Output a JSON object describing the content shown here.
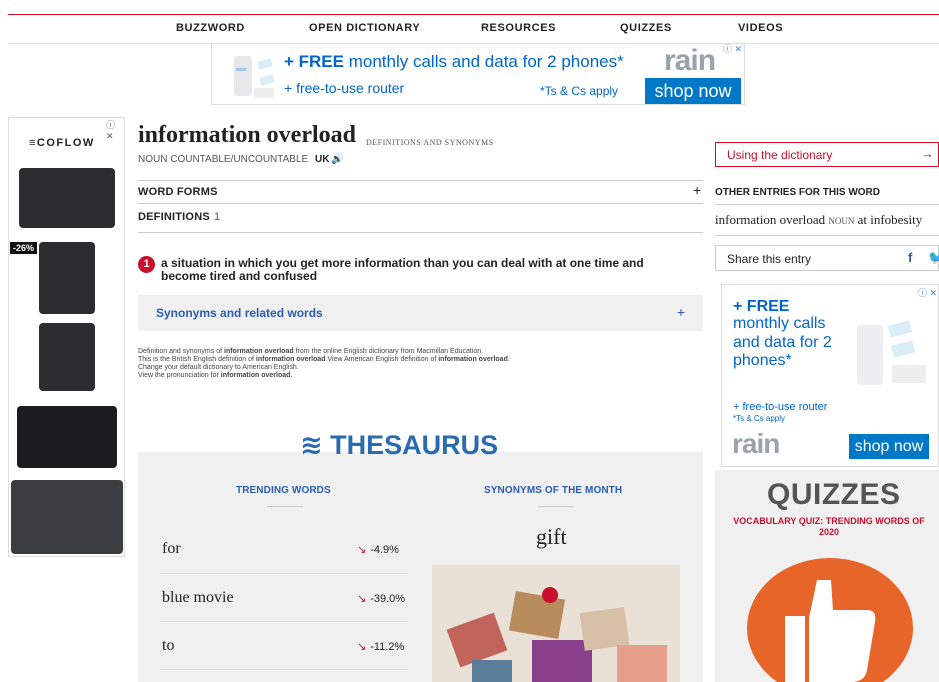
{
  "nav": {
    "items": [
      "BUZZWORD",
      "OPEN DICTIONARY",
      "RESOURCES",
      "QUIZZES",
      "VIDEOS"
    ]
  },
  "top_ad": {
    "free": "+ FREE",
    "line1_rest": " monthly calls and data for 2 phones*",
    "line2": "+ free-to-use router",
    "terms": "*Ts & Cs apply",
    "logo": "rain",
    "cta": "shop now"
  },
  "left_ad": {
    "brand": "≡COFLOW",
    "discount": "-26%"
  },
  "entry": {
    "headword": "information overload",
    "subtitle": "DEFINITIONS AND SYNONYMS",
    "pos": "NOUN COUNTABLE/UNCOUNTABLE",
    "region": "UK",
    "speaker_icon": "🔊",
    "word_forms": "WORD FORMS",
    "definitions": "DEFINITIONS",
    "def_count": "1",
    "def_number": "1",
    "definition": "a situation in which you get more information than you can deal with at one time and become tired and confused",
    "synonyms": "Synonyms and related words",
    "footnote": {
      "l1a": "Definition and synonyms of ",
      "l1b": "information overload",
      "l1c": " from the online English dictionary from Macmillan Education.",
      "l2a": "This is the British English definition of ",
      "l2b": "information overload",
      "l2c": ".View American English definition of ",
      "l2d": "information overload",
      "l2e": ".",
      "l3": "Change your default dictionary to American English.",
      "l4a": "View the pronunciation for ",
      "l4b": "information overload",
      "l4c": "."
    }
  },
  "thesaurus": {
    "title": "THESAURUS",
    "trending_head": "TRENDING WORDS",
    "month_head": "SYNONYMS OF THE MONTH",
    "trending": [
      {
        "word": "for",
        "change": "-4.9%"
      },
      {
        "word": "blue movie",
        "change": "-39.0%"
      },
      {
        "word": "to",
        "change": "-11.2%"
      }
    ],
    "month_word": "gift"
  },
  "sidebar": {
    "using": "Using the dictionary",
    "arrow": "→",
    "other_head": "OTHER ENTRIES FOR THIS WORD",
    "other_word": "information overload",
    "other_pos": "NOUN",
    "other_rest": " at infobesity",
    "share": "Share this entry",
    "fb": "f",
    "tw": "🐦"
  },
  "right_ad": {
    "free": "+ FREE",
    "text": "monthly calls and data for 2 phones*",
    "router": "+ free-to-use router",
    "terms": "*Ts & Cs apply",
    "logo": "rain",
    "cta": "shop now"
  },
  "quizzes": {
    "title": "QUIZZES",
    "quiz_title_1": "VOCABULARY QUIZ: TRENDING WORDS OF",
    "quiz_title_2": "2020"
  },
  "colors": {
    "brand_red": "#c8102e",
    "link_blue": "#2a5db0",
    "ad_blue": "#0078c8"
  }
}
